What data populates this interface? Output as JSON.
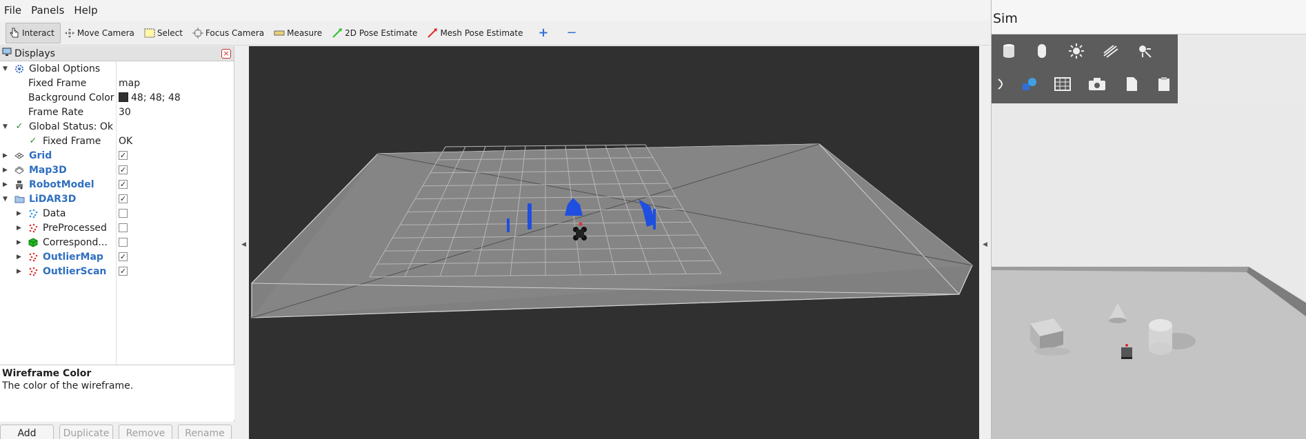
{
  "menubar": {
    "items": [
      "File",
      "Panels",
      "Help"
    ]
  },
  "toolbar": {
    "tools": [
      {
        "label": "Interact",
        "icon": "cursor-hand-icon",
        "active": true
      },
      {
        "label": "Move Camera",
        "icon": "move-camera-icon"
      },
      {
        "label": "Select",
        "icon": "select-box-icon"
      },
      {
        "label": "Focus Camera",
        "icon": "focus-camera-icon"
      },
      {
        "label": "Measure",
        "icon": "ruler-icon"
      },
      {
        "label": "2D Pose Estimate",
        "icon": "green-arrow-icon"
      },
      {
        "label": "Mesh Pose Estimate",
        "icon": "red-arrow-icon"
      }
    ],
    "add_tool_icon": "plus-icon",
    "remove_tool_icon": "minus-icon"
  },
  "displays": {
    "title": "Displays",
    "rows": [
      {
        "label": "Global Options",
        "icon": "gear-icon"
      },
      {
        "label": "Fixed Frame",
        "value": "map"
      },
      {
        "label": "Background Color",
        "value": "48; 48; 48"
      },
      {
        "label": "Frame Rate",
        "value": "30"
      },
      {
        "label": "Global Status: Ok",
        "icon": "check-icon"
      },
      {
        "label": "Fixed Frame",
        "value": "OK",
        "icon": "check-icon"
      },
      {
        "label": "Grid",
        "icon": "grid-icon",
        "checked": true
      },
      {
        "label": "Map3D",
        "icon": "map-icon",
        "checked": true
      },
      {
        "label": "RobotModel",
        "icon": "robot-icon",
        "checked": true
      },
      {
        "label": "LiDAR3D",
        "icon": "folder-icon",
        "checked": true
      },
      {
        "label": "Data",
        "icon": "pointcloud-blue-icon",
        "checked": false
      },
      {
        "label": "PreProcessed",
        "icon": "pointcloud-red-icon",
        "checked": false
      },
      {
        "label": "Correspond...",
        "icon": "cube-green-icon",
        "checked": false
      },
      {
        "label": "OutlierMap",
        "icon": "pointcloud-red-icon",
        "checked": true
      },
      {
        "label": "OutlierScan",
        "icon": "pointcloud-red-icon",
        "checked": true
      }
    ],
    "background_color": "#303030",
    "description": {
      "title": "Wireframe Color",
      "text": "The color of the wireframe."
    },
    "buttons": [
      "Add",
      "Duplicate",
      "Remove",
      "Rename"
    ]
  },
  "viewport": {
    "background": "#303030",
    "grid_color": "#9a9a9a",
    "map_color": "#8a8a8a",
    "pointcloud_color": "#1f4fe0"
  },
  "sim": {
    "title": "Sim",
    "tool_icons": [
      "cylinder-icon",
      "capsule-icon",
      "sun-icon",
      "directional-light-icon",
      "spot-light-icon",
      "joint-icon",
      "shapes-icon",
      "grid-view-icon",
      "camera-icon",
      "copy-icon",
      "paste-icon"
    ]
  }
}
